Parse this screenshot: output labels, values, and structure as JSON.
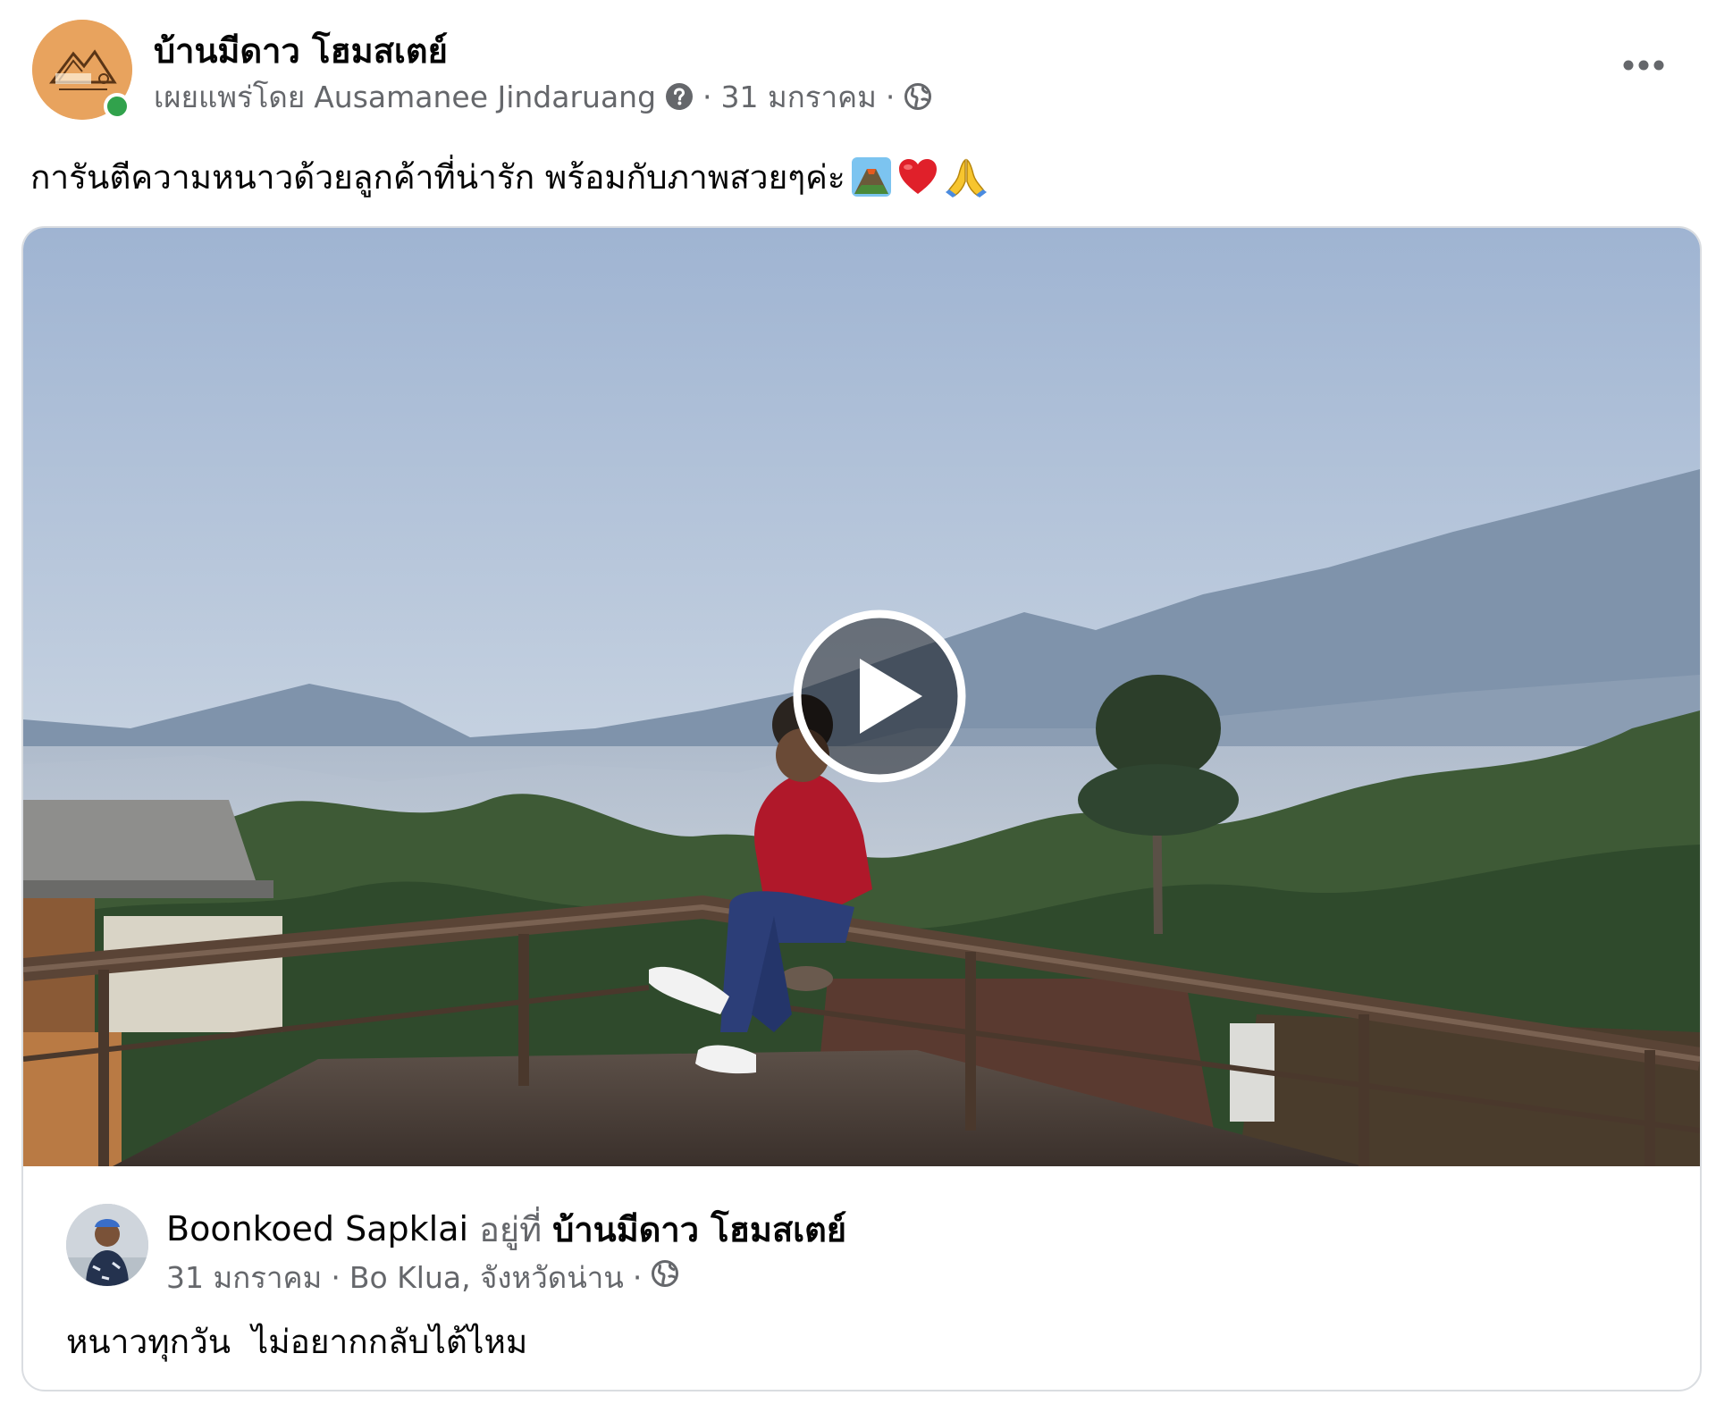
{
  "post": {
    "page_name": "บ้านมีดาว โฮมสเตย์",
    "meta": {
      "published_by_prefix": "เผยแพร่โดย",
      "published_by": "Ausamanee Jindaruang",
      "separator": "·",
      "date": "31 มกราคม",
      "separator2": "·",
      "icons": [
        "question-icon",
        "globe-icon"
      ]
    },
    "text": "การันตีความหนาวด้วยลูกค้าที่น่ารัก พร้อมกับภาพสวยๆค่ะ",
    "emojis": [
      "volcano-emoji",
      "heart-emoji",
      "folded-hands-emoji"
    ],
    "more_icon": "more-dots-icon"
  },
  "shared": {
    "author_name": "Boonkoed Sapklai",
    "at_label": "อยู่ที่",
    "place": "บ้านมีดาว โฮมสเตย์",
    "date": "31 มกราคม",
    "sep1": "·",
    "location": "Bo Klua, จังหวัดน่าน",
    "sep2": "·",
    "text": "หนาวทุกวัน  ไม่อยากกลับไต้ไหม"
  },
  "colors": {
    "secondary_text": "#65676b",
    "online": "#31a24c",
    "avatar_bg": "#e8a35e",
    "border": "#dadde1"
  }
}
